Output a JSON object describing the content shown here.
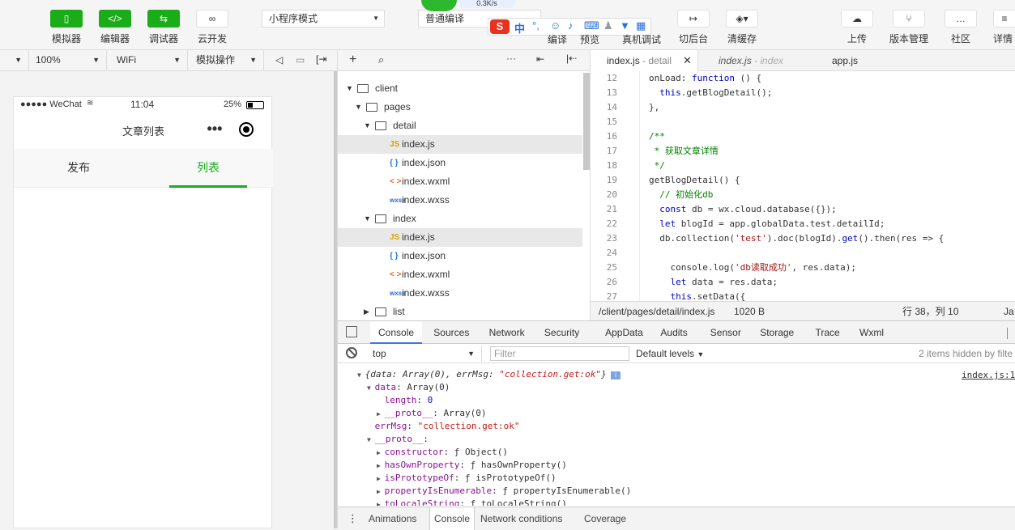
{
  "toolbar": {
    "buttons": [
      {
        "label": "模拟器",
        "icon": "phone-icon"
      },
      {
        "label": "编辑器",
        "icon": "code-icon"
      },
      {
        "label": "调试器",
        "icon": "debug-icon"
      },
      {
        "label": "云开发",
        "icon": "cloud-link-icon"
      }
    ],
    "mode_select": "小程序模式",
    "compile_select": "普通编译",
    "net_speed": "0.3K/s",
    "partial_labels": [
      "编译",
      "预览",
      "真机调试"
    ],
    "right_buttons": [
      {
        "label": "切后台",
        "icon": "switch-bg-icon"
      },
      {
        "label": "清缓存",
        "icon": "layers-icon"
      },
      {
        "label": "上传",
        "icon": "upload-icon"
      },
      {
        "label": "版本管理",
        "icon": "branch-icon"
      },
      {
        "label": "社区",
        "icon": "chat-icon"
      },
      {
        "label": "详情",
        "icon": "menu-icon"
      }
    ],
    "ime_label": "中"
  },
  "simbar": {
    "zoom": "100%",
    "network": "WiFi",
    "sim_action": "模拟操作"
  },
  "phone": {
    "carrier": "●●●●● WeChat",
    "time": "11:04",
    "battery": "25%",
    "nav_title": "文章列表",
    "tabs": [
      {
        "label": "发布",
        "active": false
      },
      {
        "label": "列表",
        "active": true
      }
    ],
    "accent_color": "#1aad19"
  },
  "filetree": {
    "rows": [
      {
        "label": "client",
        "type": "folder",
        "indent": 0,
        "expanded": true
      },
      {
        "label": "pages",
        "type": "folder",
        "indent": 1,
        "expanded": true
      },
      {
        "label": "detail",
        "type": "folder",
        "indent": 2,
        "expanded": true
      },
      {
        "label": "index.js",
        "type": "js",
        "indent": 3,
        "selected": true
      },
      {
        "label": "index.json",
        "type": "json",
        "indent": 3
      },
      {
        "label": "index.wxml",
        "type": "wxml",
        "indent": 3
      },
      {
        "label": "index.wxss",
        "type": "wxss",
        "indent": 3
      },
      {
        "label": "index",
        "type": "folder",
        "indent": 2,
        "expanded": true
      },
      {
        "label": "index.js",
        "type": "js",
        "indent": 3,
        "selected": true
      },
      {
        "label": "index.json",
        "type": "json",
        "indent": 3
      },
      {
        "label": "index.wxml",
        "type": "wxml",
        "indent": 3
      },
      {
        "label": "index.wxss",
        "type": "wxss",
        "indent": 3
      },
      {
        "label": "list",
        "type": "folder",
        "indent": 2,
        "expanded": false
      }
    ],
    "ext_labels": {
      "js": "JS",
      "json": "{ }",
      "wxml": "< >",
      "wxss": "wxss"
    }
  },
  "editor": {
    "tabs": [
      {
        "name": "index.js",
        "suffix": " - detail",
        "active": true
      },
      {
        "name": "index.js",
        "suffix": " - index",
        "active": false
      },
      {
        "name": "app.js",
        "suffix": "",
        "active": false
      }
    ],
    "lines": [
      {
        "n": "12",
        "segs": [
          [
            "",
            "onLoad: "
          ],
          [
            "kw",
            "function"
          ],
          [
            "",
            " () {"
          ]
        ]
      },
      {
        "n": "13",
        "segs": [
          [
            "",
            "  "
          ],
          [
            "kw",
            "this"
          ],
          [
            "",
            ".getBlogDetail();"
          ]
        ]
      },
      {
        "n": "14",
        "segs": [
          [
            "",
            "},"
          ]
        ]
      },
      {
        "n": "15",
        "segs": [
          [
            "",
            ""
          ]
        ]
      },
      {
        "n": "16",
        "segs": [
          [
            "cmt",
            "/**"
          ]
        ]
      },
      {
        "n": "17",
        "segs": [
          [
            "cmt",
            " * 获取文章详情"
          ]
        ]
      },
      {
        "n": "18",
        "segs": [
          [
            "cmt",
            " */"
          ]
        ]
      },
      {
        "n": "19",
        "segs": [
          [
            "",
            "getBlogDetail() {"
          ]
        ]
      },
      {
        "n": "20",
        "segs": [
          [
            "",
            "  "
          ],
          [
            "cmt",
            "// 初始化db"
          ]
        ]
      },
      {
        "n": "21",
        "segs": [
          [
            "",
            "  "
          ],
          [
            "kw",
            "const"
          ],
          [
            "",
            " db = wx.cloud.database({});"
          ]
        ]
      },
      {
        "n": "22",
        "segs": [
          [
            "",
            "  "
          ],
          [
            "kw",
            "let"
          ],
          [
            "",
            " blogId = app.globalData.test.detailId;"
          ]
        ]
      },
      {
        "n": "23",
        "segs": [
          [
            "",
            "  db.collection("
          ],
          [
            "str",
            "'test'"
          ],
          [
            "",
            ").doc(blogId)."
          ],
          [
            "kw",
            "get"
          ],
          [
            "",
            "().then(res => {"
          ]
        ]
      },
      {
        "n": "24",
        "segs": [
          [
            "",
            ""
          ]
        ]
      },
      {
        "n": "25",
        "segs": [
          [
            "",
            "    console.log("
          ],
          [
            "str",
            "'db读取成功'"
          ],
          [
            "",
            ", res.data);"
          ]
        ]
      },
      {
        "n": "26",
        "segs": [
          [
            "",
            "    "
          ],
          [
            "kw",
            "let"
          ],
          [
            "",
            " data = res.data;"
          ]
        ]
      },
      {
        "n": "27",
        "segs": [
          [
            "",
            "    "
          ],
          [
            "kw",
            "this"
          ],
          [
            "",
            ".setData({"
          ]
        ]
      }
    ],
    "status_path": "/client/pages/detail/index.js",
    "status_size": "1020 B",
    "status_pos": "行 38，列 10",
    "status_lang": "Ja"
  },
  "devtools": {
    "tabs": [
      "Console",
      "Sources",
      "Network",
      "Security",
      "AppData",
      "Audits",
      "Sensor",
      "Storage",
      "Trace",
      "Wxml"
    ],
    "active_tab": "Console",
    "context": "top",
    "filter_placeholder": "Filter",
    "levels": "Default levels",
    "hidden_note": "2 items hidden by filte",
    "source_link": "index.js:1",
    "console": [
      {
        "indent": 0,
        "tri": "▼",
        "segs": [
          [
            "",
            "{data: Array(0), errMsg: "
          ],
          [
            "cstr",
            "\"collection.get:ok\""
          ],
          [
            "",
            "}"
          ]
        ],
        "italic": true
      },
      {
        "indent": 1,
        "tri": "▼",
        "segs": [
          [
            "prop",
            "data"
          ],
          [
            "",
            ": Array(0)"
          ]
        ]
      },
      {
        "indent": 2,
        "tri": "",
        "segs": [
          [
            "prop",
            "length"
          ],
          [
            "",
            ": "
          ],
          [
            "cnum",
            "0"
          ]
        ]
      },
      {
        "indent": 2,
        "tri": "▶",
        "segs": [
          [
            "prop",
            "__proto__"
          ],
          [
            "",
            ": Array(0)"
          ]
        ]
      },
      {
        "indent": 1,
        "tri": "",
        "segs": [
          [
            "prop",
            "errMsg"
          ],
          [
            "",
            ": "
          ],
          [
            "cstr",
            "\"collection.get:ok\""
          ]
        ]
      },
      {
        "indent": 1,
        "tri": "▼",
        "segs": [
          [
            "prop",
            "__proto__"
          ],
          [
            "",
            ":"
          ]
        ]
      },
      {
        "indent": 2,
        "tri": "▶",
        "segs": [
          [
            "prop",
            "constructor"
          ],
          [
            "",
            ": ƒ Object()"
          ]
        ]
      },
      {
        "indent": 2,
        "tri": "▶",
        "segs": [
          [
            "prop",
            "hasOwnProperty"
          ],
          [
            "",
            ": ƒ hasOwnProperty()"
          ]
        ]
      },
      {
        "indent": 2,
        "tri": "▶",
        "segs": [
          [
            "prop",
            "isPrototypeOf"
          ],
          [
            "",
            ": ƒ isPrototypeOf()"
          ]
        ]
      },
      {
        "indent": 2,
        "tri": "▶",
        "segs": [
          [
            "prop",
            "propertyIsEnumerable"
          ],
          [
            "",
            ": ƒ propertyIsEnumerable()"
          ]
        ]
      },
      {
        "indent": 2,
        "tri": "▶",
        "segs": [
          [
            "prop",
            "toLocaleString"
          ],
          [
            "",
            ": ƒ toLocaleString()"
          ]
        ]
      }
    ],
    "drawer_tabs": [
      "Animations",
      "Console",
      "Network conditions",
      "Coverage"
    ],
    "drawer_active": "Console"
  }
}
